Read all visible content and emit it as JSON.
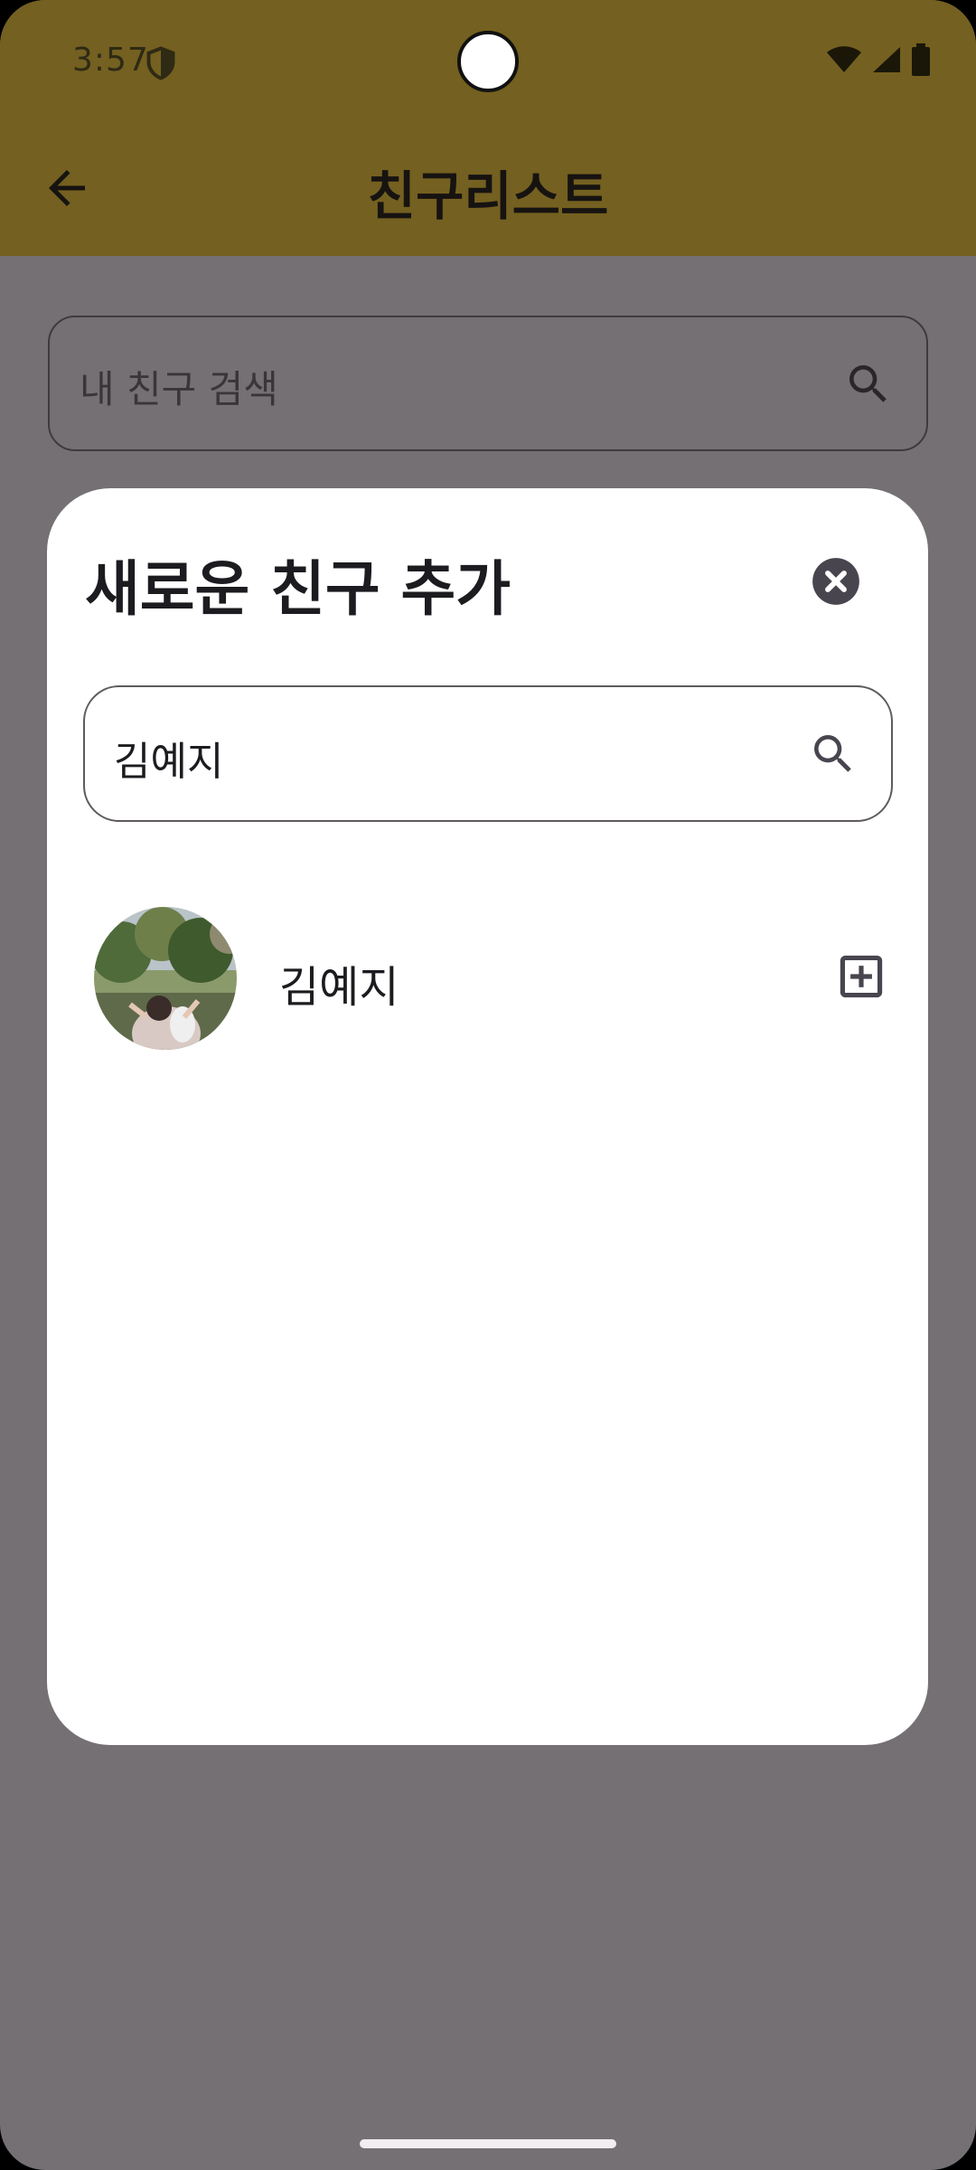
{
  "status_bar": {
    "time": "3:57",
    "icons": [
      "shield-icon",
      "wifi-icon",
      "signal-icon",
      "battery-icon"
    ]
  },
  "app_bar": {
    "title": "친구리스트",
    "back_icon": "arrow-back-icon"
  },
  "background_search": {
    "placeholder": "내 친구 검색",
    "icon": "search-icon"
  },
  "dialog": {
    "title": "새로운 친구 추가",
    "close_icon": "close-circle-icon",
    "search": {
      "value": "김예지",
      "icon": "search-icon"
    },
    "results": [
      {
        "name": "김예지",
        "avatar": "profile-photo",
        "action_icon": "add-box-icon"
      }
    ]
  },
  "colors": {
    "scrim": "#747074",
    "app_bar_dimmed": "#746020",
    "dialog_bg": "#ffffff",
    "text_primary": "#1c1b1f"
  }
}
